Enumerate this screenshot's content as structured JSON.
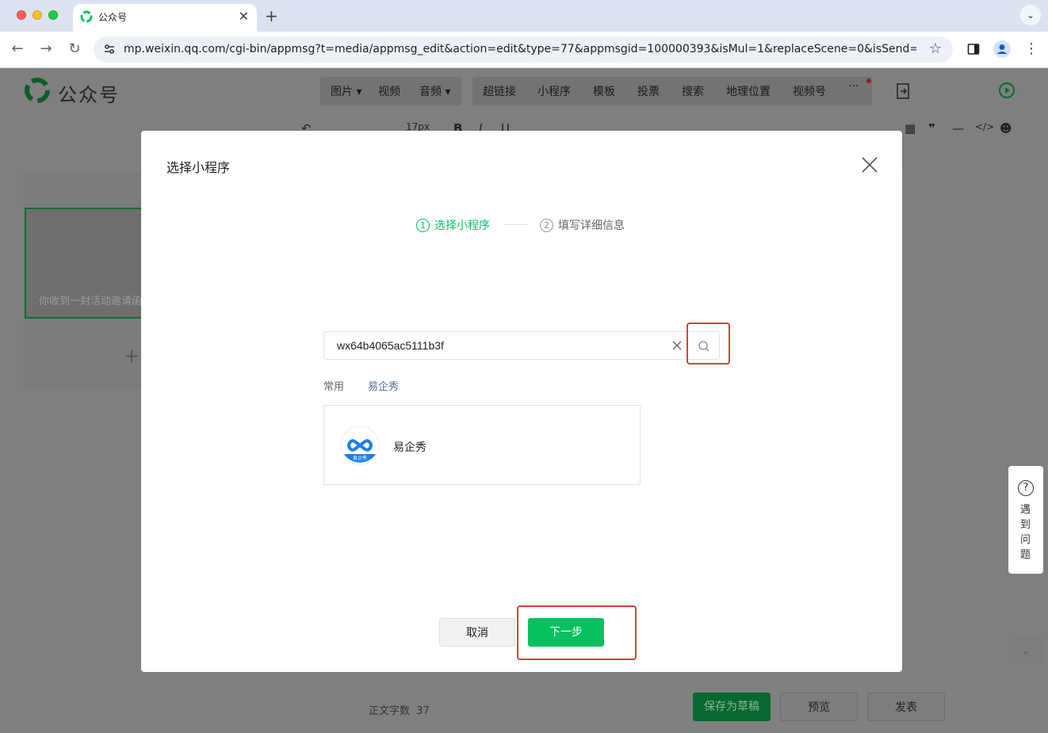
{
  "browser": {
    "tab_title": "公众号",
    "url": "mp.weixin.qq.com/cgi-bin/appmsg?t=media/appmsg_edit&action=edit&type=77&appmsgid=100000393&isMul=1&replaceScene=0&isSend=0&isFree...",
    "new_tab": "+",
    "tab_close": "✕"
  },
  "app": {
    "name": "公众号",
    "menu": [
      "图片 ▾",
      "视频",
      "音频 ▾",
      "超链接",
      "小程序",
      "模板",
      "投票",
      "搜索",
      "地理位置",
      "视频号",
      "···"
    ],
    "font_size": "17px",
    "article_preview": "你收到一封活动邀请函",
    "word_count_label": "正文字数",
    "word_count_value": "37",
    "save_draft": "保存为草稿",
    "preview": "预览",
    "publish": "发表",
    "help_q": "?",
    "help_text": "遇到问题"
  },
  "modal": {
    "title": "选择小程序",
    "steps": [
      {
        "num": "1",
        "label": "选择小程序",
        "active": true
      },
      {
        "num": "2",
        "label": "填写详细信息",
        "active": false
      }
    ],
    "search": {
      "value": "wx64b4065ac5111b3f",
      "placeholder": ""
    },
    "categories": {
      "label": "常用",
      "link": "易企秀"
    },
    "result": {
      "name": "易企秀",
      "logo_caption": "易企秀"
    },
    "buttons": {
      "cancel": "取消",
      "next": "下一步"
    }
  },
  "colors": {
    "accent": "#07c160",
    "link": "#576b95",
    "highlight": "#e53935"
  }
}
